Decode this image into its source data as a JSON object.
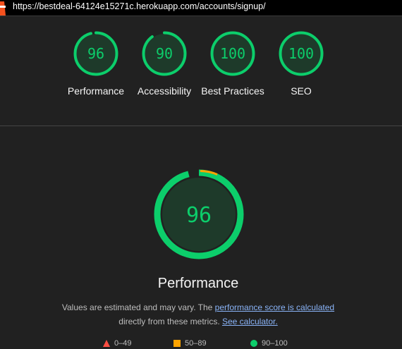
{
  "browser": {
    "url": "https://bestdeal-64124e15271c.herokuapp.com/accounts/signup/"
  },
  "summary": {
    "gauges": [
      {
        "score": "96",
        "value": 96,
        "label": "Performance"
      },
      {
        "score": "90",
        "value": 90,
        "label": "Accessibility"
      },
      {
        "score": "100",
        "value": 100,
        "label": "Best Practices"
      },
      {
        "score": "100",
        "value": 100,
        "label": "SEO"
      }
    ]
  },
  "performance": {
    "score": "96",
    "value": 96,
    "title": "Performance",
    "desc_prefix": "Values are estimated and may vary. The ",
    "desc_link": "performance score is calculated",
    "desc_middle": "directly from these metrics. ",
    "desc_calc_link": "See calculator."
  },
  "legend": {
    "fail": "0–49",
    "average": "50–89",
    "pass": "90–100"
  },
  "colors": {
    "pass": "#0cce6b",
    "average": "#ffa400",
    "fail": "#ff4e42",
    "pass_fill": "#1e3a2a"
  }
}
